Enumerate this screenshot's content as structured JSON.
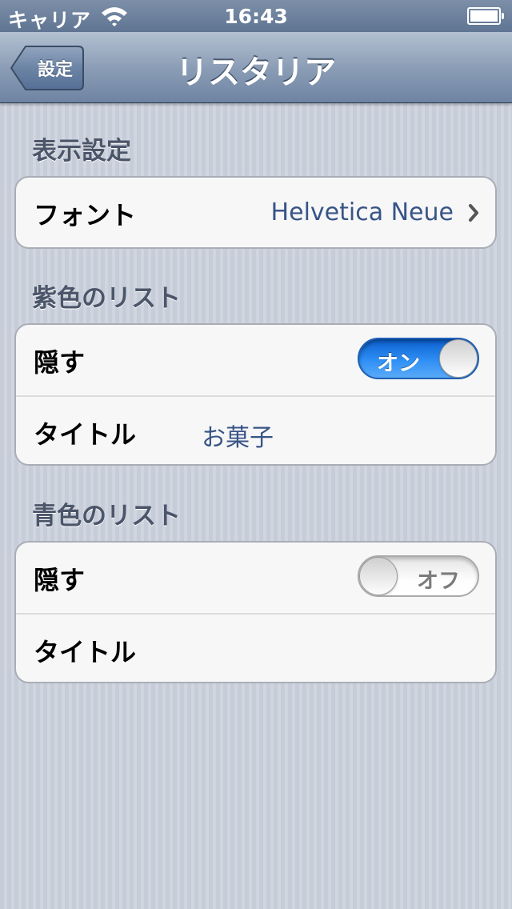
{
  "status_bar": {
    "carrier": "キャリア",
    "time": "16:43",
    "wifi_icon": "wifi-icon",
    "battery_icon": "battery-full-icon"
  },
  "nav": {
    "title": "リスタリア",
    "back_label": "設定"
  },
  "sections": {
    "display": {
      "header": "表示設定",
      "font_label": "フォント",
      "font_value": "Helvetica Neue"
    },
    "purple": {
      "header": "紫色のリスト",
      "hide_label": "隠す",
      "hide_state": "オン",
      "hide_on": true,
      "title_label": "タイトル",
      "title_value": "お菓子"
    },
    "blue": {
      "header": "青色のリスト",
      "hide_label": "隠す",
      "hide_state": "オフ",
      "hide_on": false,
      "title_label": "タイトル",
      "title_value": ""
    }
  },
  "colors": {
    "accent_blue": "#2f8ff5",
    "value_text": "#385487",
    "nav_bar": "#8c9eb6"
  }
}
